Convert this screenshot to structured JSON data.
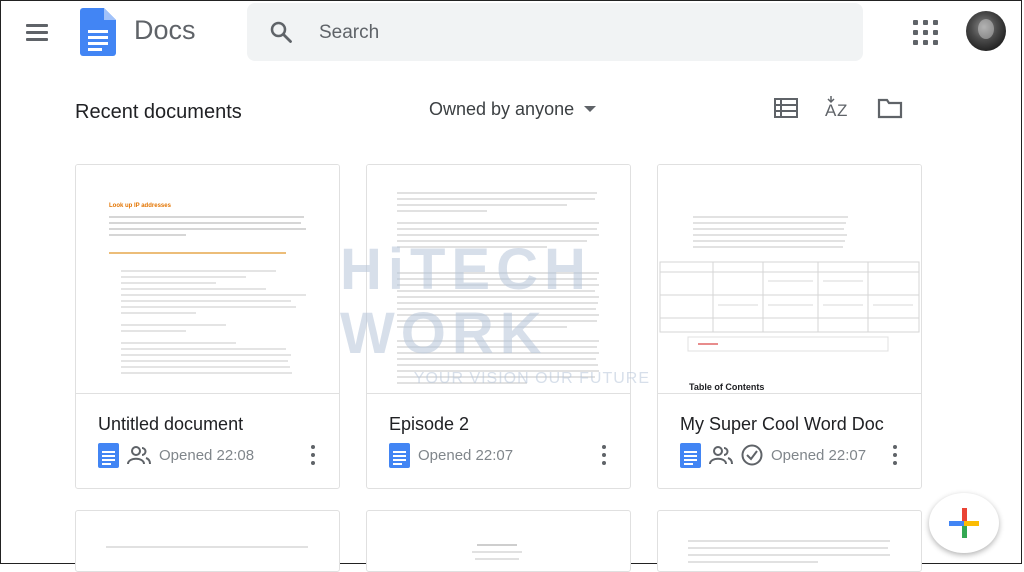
{
  "app": {
    "name": "Docs"
  },
  "search": {
    "placeholder": "Search"
  },
  "toolbar": {
    "section_title": "Recent documents",
    "owner_filter": "Owned by anyone",
    "view_icon": "list-view-icon",
    "sort_icon": "sort-az-icon",
    "folder_icon": "folder-icon"
  },
  "documents": [
    {
      "title": "Untitled document",
      "opened": "Opened 22:08",
      "shared": true,
      "preview_heading": "Look up IP addresses"
    },
    {
      "title": "Episode 2",
      "opened": "Opened 22:07",
      "shared": false
    },
    {
      "title": "My Super Cool Word Doc",
      "opened": "Opened 22:07",
      "shared": true,
      "preview_heading": "Table of Contents"
    }
  ],
  "watermark": {
    "brand": "HiTECH WORK",
    "tagline": "YOUR VISION OUR FUTURE"
  },
  "colors": {
    "docs_blue": "#4285f4",
    "text_dark": "#202124",
    "text_grey": "#5f6368",
    "search_bg": "#f1f3f4"
  },
  "icons": [
    "menu-icon",
    "docs-logo-icon",
    "search-icon",
    "apps-grid-icon",
    "people-icon",
    "check-circle-icon",
    "more-vert-icon",
    "new-doc-plus-icon"
  ]
}
